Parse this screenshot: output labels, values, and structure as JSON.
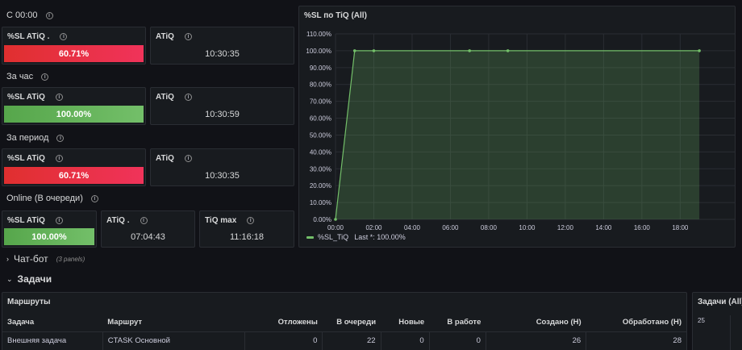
{
  "groups": [
    {
      "label": "С 00:00",
      "sl_title": "%SL ATiQ .",
      "sl_value": "60.71%",
      "sl_color": "red",
      "atiq_title": "ATiQ",
      "atiq_value": "10:30:35"
    },
    {
      "label": "За час",
      "sl_title": "%SL ATiQ",
      "sl_value": "100.00%",
      "sl_color": "green",
      "atiq_title": "ATiQ",
      "atiq_value": "10:30:59"
    },
    {
      "label": "За период",
      "sl_title": "%SL ATiQ",
      "sl_value": "60.71%",
      "sl_color": "red",
      "atiq_title": "ATiQ",
      "atiq_value": "10:30:35"
    }
  ],
  "online": {
    "label": "Online (В очереди)",
    "sl_title": "%SL ATiQ",
    "sl_value": "100.00%",
    "atiq_title": "ATiQ .",
    "atiq_value": "07:04:43",
    "tiq_title": "TiQ max",
    "tiq_value": "11:16:18"
  },
  "chart_panel": {
    "title": "%SL по TiQ (All)",
    "legend_name": "%SL_TiQ",
    "legend_last": "Last *: 100.00%"
  },
  "chart_data": {
    "type": "area",
    "x": [
      "00:00",
      "01:00",
      "02:00",
      "07:00",
      "09:00",
      "19:00"
    ],
    "series": [
      {
        "name": "%SL_TiQ",
        "values": [
          0,
          100,
          100,
          100,
          100,
          100
        ]
      }
    ],
    "y_ticks": [
      "0.00%",
      "10.00%",
      "20.00%",
      "30.00%",
      "40.00%",
      "50.00%",
      "60.00%",
      "70.00%",
      "80.00%",
      "90.00%",
      "100.00%",
      "110.00%"
    ],
    "x_ticks": [
      "00:00",
      "02:00",
      "04:00",
      "06:00",
      "08:00",
      "10:00",
      "12:00",
      "14:00",
      "16:00",
      "18:00"
    ],
    "ylim": [
      0,
      110
    ],
    "colors": {
      "line": "#73bf69",
      "fill": "#73bf69"
    }
  },
  "rows": {
    "chatbot": {
      "title": "Чат-бот",
      "count": "(3 panels)"
    },
    "tasks": {
      "title": "Задачи"
    }
  },
  "routes_panel": {
    "title": "Маршруты",
    "columns": [
      "Задача",
      "Маршрут",
      "Отложены",
      "В очереди",
      "Новые",
      "В работе",
      "Создано (Н)",
      "Обработано (Н)"
    ],
    "rows": [
      [
        "Внешняя задача",
        "CTASK Основной",
        "0",
        "22",
        "0",
        "0",
        "26",
        "28"
      ]
    ]
  },
  "tasks_panel": {
    "title": "Задачи (All)",
    "y_tick": "25"
  }
}
